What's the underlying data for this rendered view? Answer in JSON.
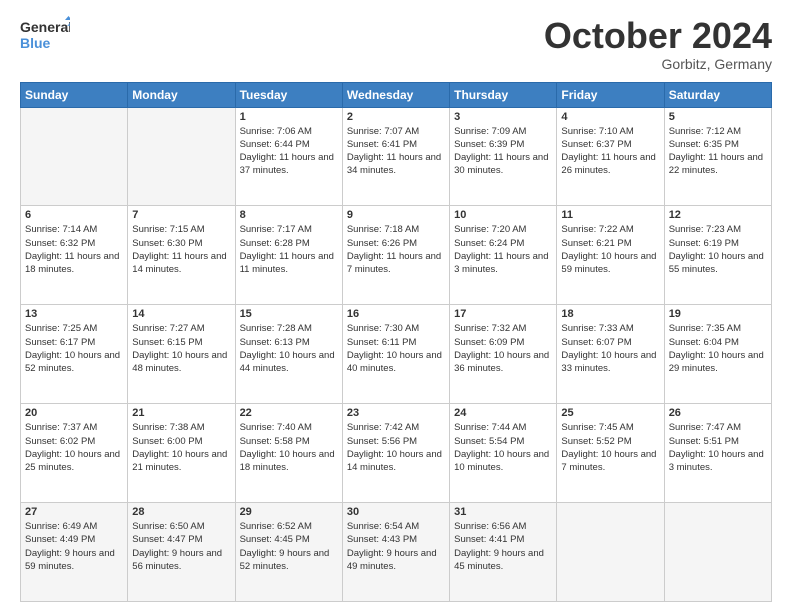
{
  "header": {
    "logo_line1": "General",
    "logo_line2": "Blue",
    "month": "October 2024",
    "location": "Gorbitz, Germany"
  },
  "weekdays": [
    "Sunday",
    "Monday",
    "Tuesday",
    "Wednesday",
    "Thursday",
    "Friday",
    "Saturday"
  ],
  "weeks": [
    [
      {
        "day": "",
        "info": ""
      },
      {
        "day": "",
        "info": ""
      },
      {
        "day": "1",
        "info": "Sunrise: 7:06 AM\nSunset: 6:44 PM\nDaylight: 11 hours and 37 minutes."
      },
      {
        "day": "2",
        "info": "Sunrise: 7:07 AM\nSunset: 6:41 PM\nDaylight: 11 hours and 34 minutes."
      },
      {
        "day": "3",
        "info": "Sunrise: 7:09 AM\nSunset: 6:39 PM\nDaylight: 11 hours and 30 minutes."
      },
      {
        "day": "4",
        "info": "Sunrise: 7:10 AM\nSunset: 6:37 PM\nDaylight: 11 hours and 26 minutes."
      },
      {
        "day": "5",
        "info": "Sunrise: 7:12 AM\nSunset: 6:35 PM\nDaylight: 11 hours and 22 minutes."
      }
    ],
    [
      {
        "day": "6",
        "info": "Sunrise: 7:14 AM\nSunset: 6:32 PM\nDaylight: 11 hours and 18 minutes."
      },
      {
        "day": "7",
        "info": "Sunrise: 7:15 AM\nSunset: 6:30 PM\nDaylight: 11 hours and 14 minutes."
      },
      {
        "day": "8",
        "info": "Sunrise: 7:17 AM\nSunset: 6:28 PM\nDaylight: 11 hours and 11 minutes."
      },
      {
        "day": "9",
        "info": "Sunrise: 7:18 AM\nSunset: 6:26 PM\nDaylight: 11 hours and 7 minutes."
      },
      {
        "day": "10",
        "info": "Sunrise: 7:20 AM\nSunset: 6:24 PM\nDaylight: 11 hours and 3 minutes."
      },
      {
        "day": "11",
        "info": "Sunrise: 7:22 AM\nSunset: 6:21 PM\nDaylight: 10 hours and 59 minutes."
      },
      {
        "day": "12",
        "info": "Sunrise: 7:23 AM\nSunset: 6:19 PM\nDaylight: 10 hours and 55 minutes."
      }
    ],
    [
      {
        "day": "13",
        "info": "Sunrise: 7:25 AM\nSunset: 6:17 PM\nDaylight: 10 hours and 52 minutes."
      },
      {
        "day": "14",
        "info": "Sunrise: 7:27 AM\nSunset: 6:15 PM\nDaylight: 10 hours and 48 minutes."
      },
      {
        "day": "15",
        "info": "Sunrise: 7:28 AM\nSunset: 6:13 PM\nDaylight: 10 hours and 44 minutes."
      },
      {
        "day": "16",
        "info": "Sunrise: 7:30 AM\nSunset: 6:11 PM\nDaylight: 10 hours and 40 minutes."
      },
      {
        "day": "17",
        "info": "Sunrise: 7:32 AM\nSunset: 6:09 PM\nDaylight: 10 hours and 36 minutes."
      },
      {
        "day": "18",
        "info": "Sunrise: 7:33 AM\nSunset: 6:07 PM\nDaylight: 10 hours and 33 minutes."
      },
      {
        "day": "19",
        "info": "Sunrise: 7:35 AM\nSunset: 6:04 PM\nDaylight: 10 hours and 29 minutes."
      }
    ],
    [
      {
        "day": "20",
        "info": "Sunrise: 7:37 AM\nSunset: 6:02 PM\nDaylight: 10 hours and 25 minutes."
      },
      {
        "day": "21",
        "info": "Sunrise: 7:38 AM\nSunset: 6:00 PM\nDaylight: 10 hours and 21 minutes."
      },
      {
        "day": "22",
        "info": "Sunrise: 7:40 AM\nSunset: 5:58 PM\nDaylight: 10 hours and 18 minutes."
      },
      {
        "day": "23",
        "info": "Sunrise: 7:42 AM\nSunset: 5:56 PM\nDaylight: 10 hours and 14 minutes."
      },
      {
        "day": "24",
        "info": "Sunrise: 7:44 AM\nSunset: 5:54 PM\nDaylight: 10 hours and 10 minutes."
      },
      {
        "day": "25",
        "info": "Sunrise: 7:45 AM\nSunset: 5:52 PM\nDaylight: 10 hours and 7 minutes."
      },
      {
        "day": "26",
        "info": "Sunrise: 7:47 AM\nSunset: 5:51 PM\nDaylight: 10 hours and 3 minutes."
      }
    ],
    [
      {
        "day": "27",
        "info": "Sunrise: 6:49 AM\nSunset: 4:49 PM\nDaylight: 9 hours and 59 minutes."
      },
      {
        "day": "28",
        "info": "Sunrise: 6:50 AM\nSunset: 4:47 PM\nDaylight: 9 hours and 56 minutes."
      },
      {
        "day": "29",
        "info": "Sunrise: 6:52 AM\nSunset: 4:45 PM\nDaylight: 9 hours and 52 minutes."
      },
      {
        "day": "30",
        "info": "Sunrise: 6:54 AM\nSunset: 4:43 PM\nDaylight: 9 hours and 49 minutes."
      },
      {
        "day": "31",
        "info": "Sunrise: 6:56 AM\nSunset: 4:41 PM\nDaylight: 9 hours and 45 minutes."
      },
      {
        "day": "",
        "info": ""
      },
      {
        "day": "",
        "info": ""
      }
    ]
  ]
}
